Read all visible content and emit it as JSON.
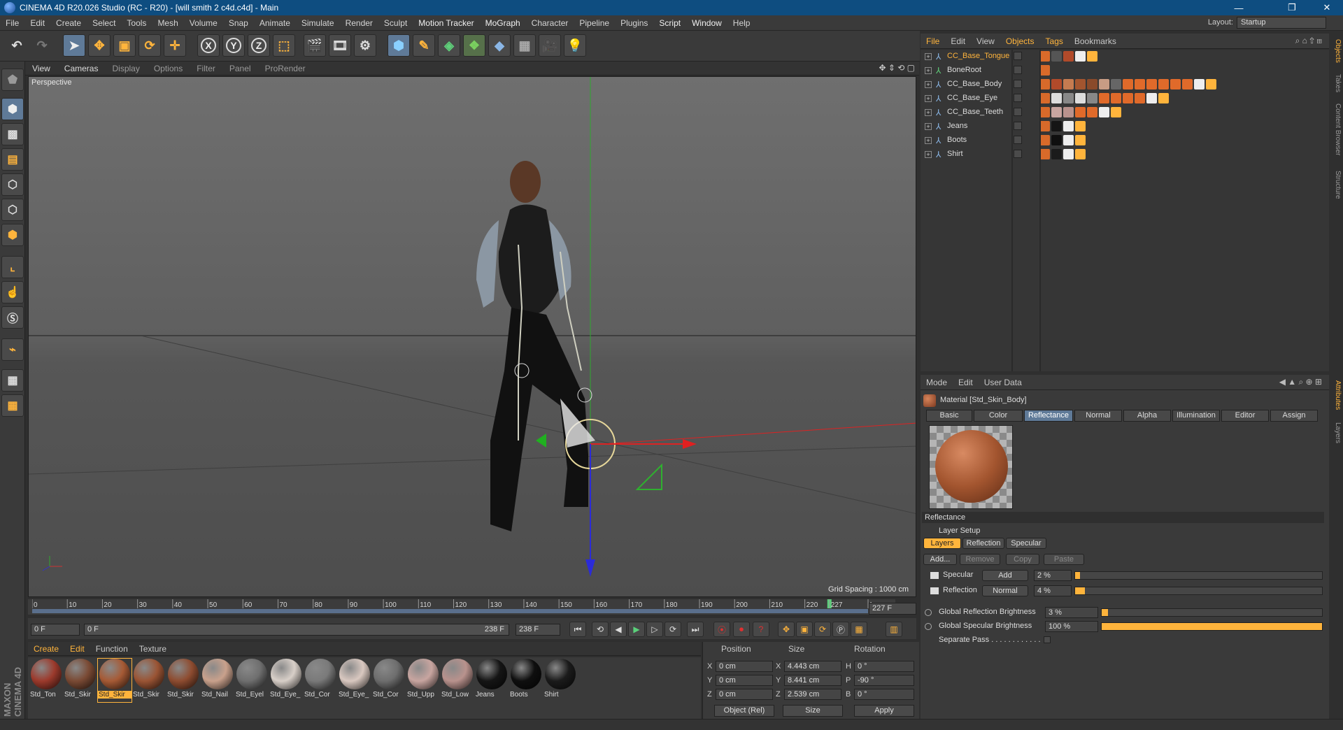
{
  "window": {
    "title": "CINEMA 4D R20.026 Studio (RC - R20) - [will smith 2 c4d.c4d] - Main",
    "min": "—",
    "max": "❐",
    "close": "✕"
  },
  "menu": [
    "File",
    "Edit",
    "Create",
    "Select",
    "Tools",
    "Mesh",
    "Volume",
    "Snap",
    "Animate",
    "Simulate",
    "Render",
    "Sculpt",
    "Motion Tracker",
    "MoGraph",
    "Character",
    "Pipeline",
    "Plugins",
    "Script",
    "Window",
    "Help"
  ],
  "layout": {
    "label": "Layout:",
    "value": "Startup"
  },
  "toolbar": {
    "x": "X",
    "y": "Y",
    "z": "Z"
  },
  "viewport": {
    "menu": [
      "View",
      "Cameras",
      "Display",
      "Options",
      "Filter",
      "Panel",
      "ProRender"
    ],
    "label": "Perspective",
    "grid_spacing": "Grid Spacing : 1000 cm"
  },
  "timeline": {
    "ticks": [
      "0",
      "10",
      "20",
      "30",
      "40",
      "50",
      "60",
      "70",
      "80",
      "90",
      "100",
      "110",
      "120",
      "130",
      "140",
      "150",
      "160",
      "170",
      "180",
      "190",
      "200",
      "210",
      "220",
      "227",
      "2"
    ],
    "current_frame_box": "227 F",
    "current_frame": 227,
    "start_field": "0 F",
    "range_left": "0 F",
    "range_right": "238 F",
    "end_field": "238 F"
  },
  "material_manager": {
    "menu": [
      "Create",
      "Edit",
      "Function",
      "Texture"
    ],
    "materials": [
      {
        "name": "Std_Ton",
        "color": "#9c3a2c"
      },
      {
        "name": "Std_Skir",
        "color": "#7a4a34"
      },
      {
        "name": "Std_Skir",
        "color": "#a65a35",
        "selected": true
      },
      {
        "name": "Std_Skir",
        "color": "#9a5434"
      },
      {
        "name": "Std_Skir",
        "color": "#8e4c30"
      },
      {
        "name": "Std_Nail",
        "color": "#c9a18c"
      },
      {
        "name": "Std_Eyel",
        "color": "#6f6f6f"
      },
      {
        "name": "Std_Eye_",
        "color": "#d8cfc8"
      },
      {
        "name": "Std_Cor",
        "color": "#7a7a7a"
      },
      {
        "name": "Std_Eye_",
        "color": "#d9c8c0"
      },
      {
        "name": "Std_Cor",
        "color": "#6e6e6e"
      },
      {
        "name": "Std_Upp",
        "color": "#c8a5a0"
      },
      {
        "name": "Std_Low",
        "color": "#b9928d"
      },
      {
        "name": "Jeans",
        "color": "#151515"
      },
      {
        "name": "Boots",
        "color": "#0f0f0f"
      },
      {
        "name": "Shirt",
        "color": "#1b1b1b"
      }
    ],
    "logo": "MAXON CINEMA 4D"
  },
  "coordinates": {
    "headers": [
      "Position",
      "Size",
      "Rotation"
    ],
    "rows": [
      {
        "axis": "X",
        "pos": "0 cm",
        "size_axis": "X",
        "size": "4.443 cm",
        "rot_axis": "H",
        "rot": "0 °"
      },
      {
        "axis": "Y",
        "pos": "0 cm",
        "size_axis": "Y",
        "size": "8.441 cm",
        "rot_axis": "P",
        "rot": "-90 °"
      },
      {
        "axis": "Z",
        "pos": "0 cm",
        "size_axis": "Z",
        "size": "2.539 cm",
        "rot_axis": "B",
        "rot": "0 °"
      }
    ],
    "mode": "Object (Rel)",
    "size_mode": "Size",
    "apply": "Apply"
  },
  "object_manager": {
    "menu": [
      "File",
      "Edit",
      "View",
      "Objects",
      "Tags",
      "Bookmarks"
    ],
    "objects": [
      {
        "name": "CC_Base_Tongue",
        "selected": true
      },
      {
        "name": "BoneRoot"
      },
      {
        "name": "CC_Base_Body"
      },
      {
        "name": "CC_Base_Eye"
      },
      {
        "name": "CC_Base_Teeth"
      },
      {
        "name": "Jeans"
      },
      {
        "name": "Boots"
      },
      {
        "name": "Shirt"
      }
    ]
  },
  "attribute_manager": {
    "menu": [
      "Mode",
      "Edit",
      "User Data"
    ],
    "material_title": "Material [Std_Skin_Body]",
    "tabs": [
      "Basic",
      "Color",
      "Reflectance",
      "Normal",
      "Alpha",
      "Illumination",
      "Editor",
      "Assign"
    ],
    "selected_tab": "Reflectance",
    "section": "Reflectance",
    "layer_setup": "Layer Setup",
    "subtabs": [
      "Layers",
      "Reflection",
      "Specular"
    ],
    "buttons": [
      "Add...",
      "Remove",
      "Copy",
      "Paste"
    ],
    "layers": [
      {
        "name": "Specular",
        "mode": "Add",
        "value": "2 %",
        "fraction": 0.02
      },
      {
        "name": "Reflection",
        "mode": "Normal",
        "value": "4 %",
        "fraction": 0.04
      }
    ],
    "global_reflection": {
      "label": "Global Reflection Brightness",
      "value": "3 %",
      "fraction": 0.03
    },
    "global_specular": {
      "label": "Global Specular Brightness",
      "value": "100 %",
      "fraction": 1.0
    },
    "separate_pass": "Separate Pass . . . . . . . . . . . ."
  },
  "side_tabs": [
    "Objects",
    "Takes",
    "Content Browser",
    "Structure",
    "Attributes",
    "Layers"
  ],
  "colors": {
    "accent": "#ffb43c",
    "title_bar": "#0e4d80",
    "selected_tab": "#5f7a98"
  }
}
